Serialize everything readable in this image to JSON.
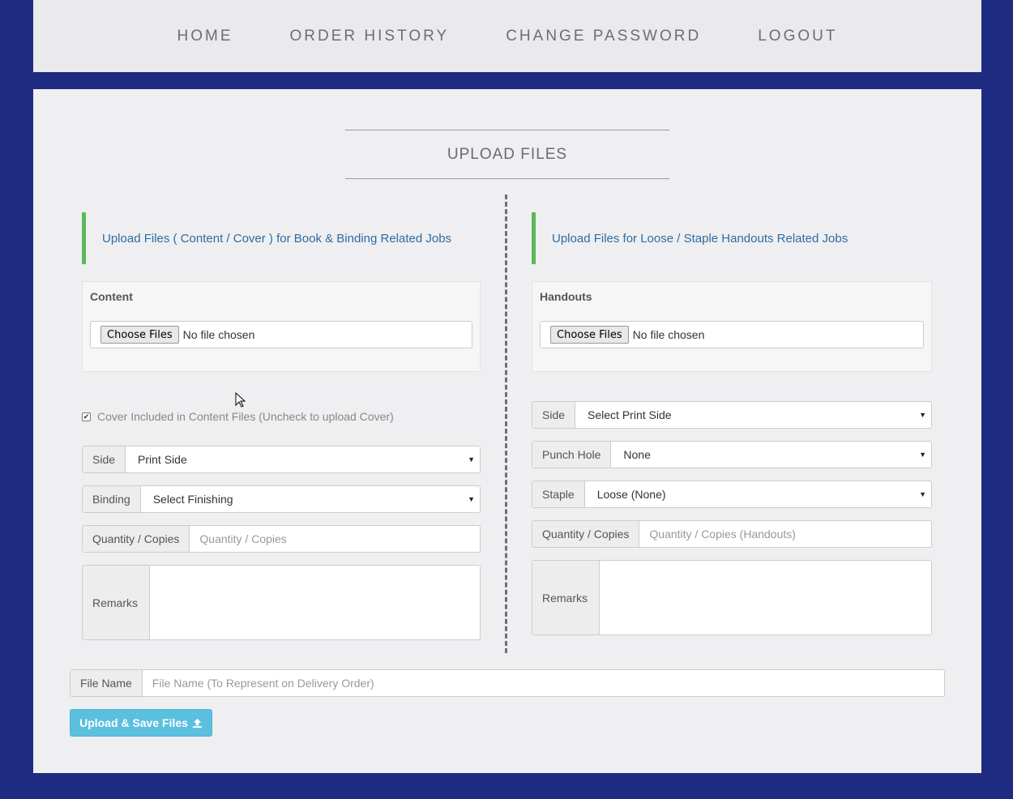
{
  "nav": {
    "items": [
      "HOME",
      "ORDER HISTORY",
      "CHANGE PASSWORD",
      "LOGOUT"
    ]
  },
  "page": {
    "title": "UPLOAD FILES"
  },
  "left": {
    "heading": "Upload Files ( Content / Cover ) for Book & Binding Related Jobs",
    "well_label": "Content",
    "choose_label": "Choose Files",
    "no_file": "No file chosen",
    "cover_checkbox": {
      "label": "Cover Included in Content Files (Uncheck to upload Cover)",
      "checked": true
    },
    "side": {
      "label": "Side",
      "value": "Print Side"
    },
    "binding": {
      "label": "Binding",
      "value": "Select Finishing"
    },
    "quantity": {
      "label": "Quantity / Copies",
      "placeholder": "Quantity / Copies"
    },
    "remarks": {
      "label": "Remarks"
    }
  },
  "right": {
    "heading": "Upload Files for Loose / Staple Handouts Related Jobs",
    "well_label": "Handouts",
    "choose_label": "Choose Files",
    "no_file": "No file chosen",
    "side": {
      "label": "Side",
      "value": "Select Print Side"
    },
    "punch": {
      "label": "Punch Hole",
      "value": "None"
    },
    "staple": {
      "label": "Staple",
      "value": "Loose (None)"
    },
    "quantity": {
      "label": "Quantity / Copies",
      "placeholder": "Quantity / Copies (Handouts)"
    },
    "remarks": {
      "label": "Remarks"
    }
  },
  "file_name": {
    "label": "File Name",
    "placeholder": "File Name (To Represent on Delivery Order)"
  },
  "submit": {
    "label": "Upload & Save Files",
    "icon": "upload-icon"
  },
  "colors": {
    "background": "#1f2b80",
    "accent_green": "#5cb85c",
    "button_info": "#5bc0de",
    "link_blue": "#2d6ca3"
  }
}
